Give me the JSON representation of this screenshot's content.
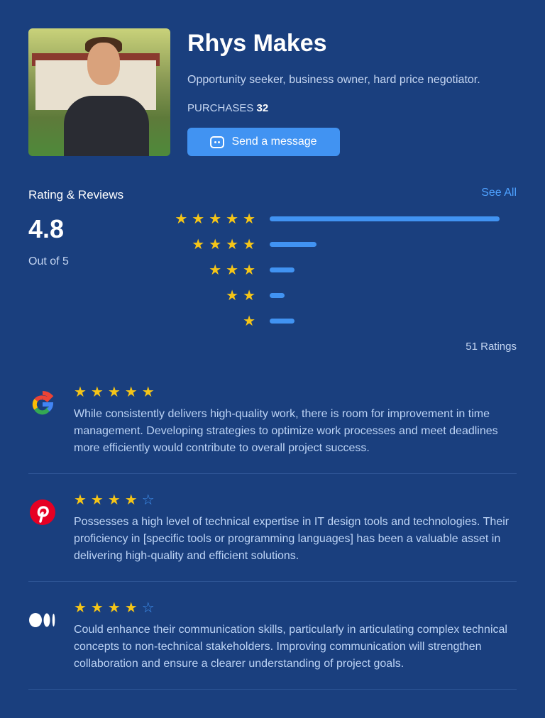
{
  "profile": {
    "name": "Rhys Makes",
    "bio": "Opportunity seeker, business owner, hard price negotiator.",
    "purchases_label": "PURCHASES",
    "purchases": "32",
    "message_button": "Send a message"
  },
  "ratings": {
    "title": "Rating & Reviews",
    "see_all": "See All",
    "score": "4.8",
    "out_of": "Out of 5",
    "count": "51 Ratings",
    "distribution": [
      {
        "stars": 5,
        "percent": 93
      },
      {
        "stars": 4,
        "percent": 19
      },
      {
        "stars": 3,
        "percent": 10
      },
      {
        "stars": 2,
        "percent": 6
      },
      {
        "stars": 1,
        "percent": 10
      }
    ]
  },
  "colors": {
    "background": "#1a3f7e",
    "accent": "#4193f2",
    "star": "#f5c518"
  },
  "reviews": [
    {
      "source": "google-icon",
      "rating": 5,
      "text": "While consistently delivers high-quality work, there is room for improvement in time management. Developing strategies to optimize work processes and meet deadlines more efficiently would contribute to overall project success."
    },
    {
      "source": "pinterest-icon",
      "rating": 4,
      "text": "Possesses a high level of technical expertise in IT design tools and technologies. Their proficiency in [specific tools or programming languages] has been a valuable asset in delivering high-quality and efficient solutions."
    },
    {
      "source": "medium-icon",
      "rating": 4,
      "text": "Could enhance their communication skills, particularly in articulating complex technical concepts to non-technical stakeholders. Improving communication will strengthen collaboration and ensure a clearer understanding of project goals."
    }
  ]
}
